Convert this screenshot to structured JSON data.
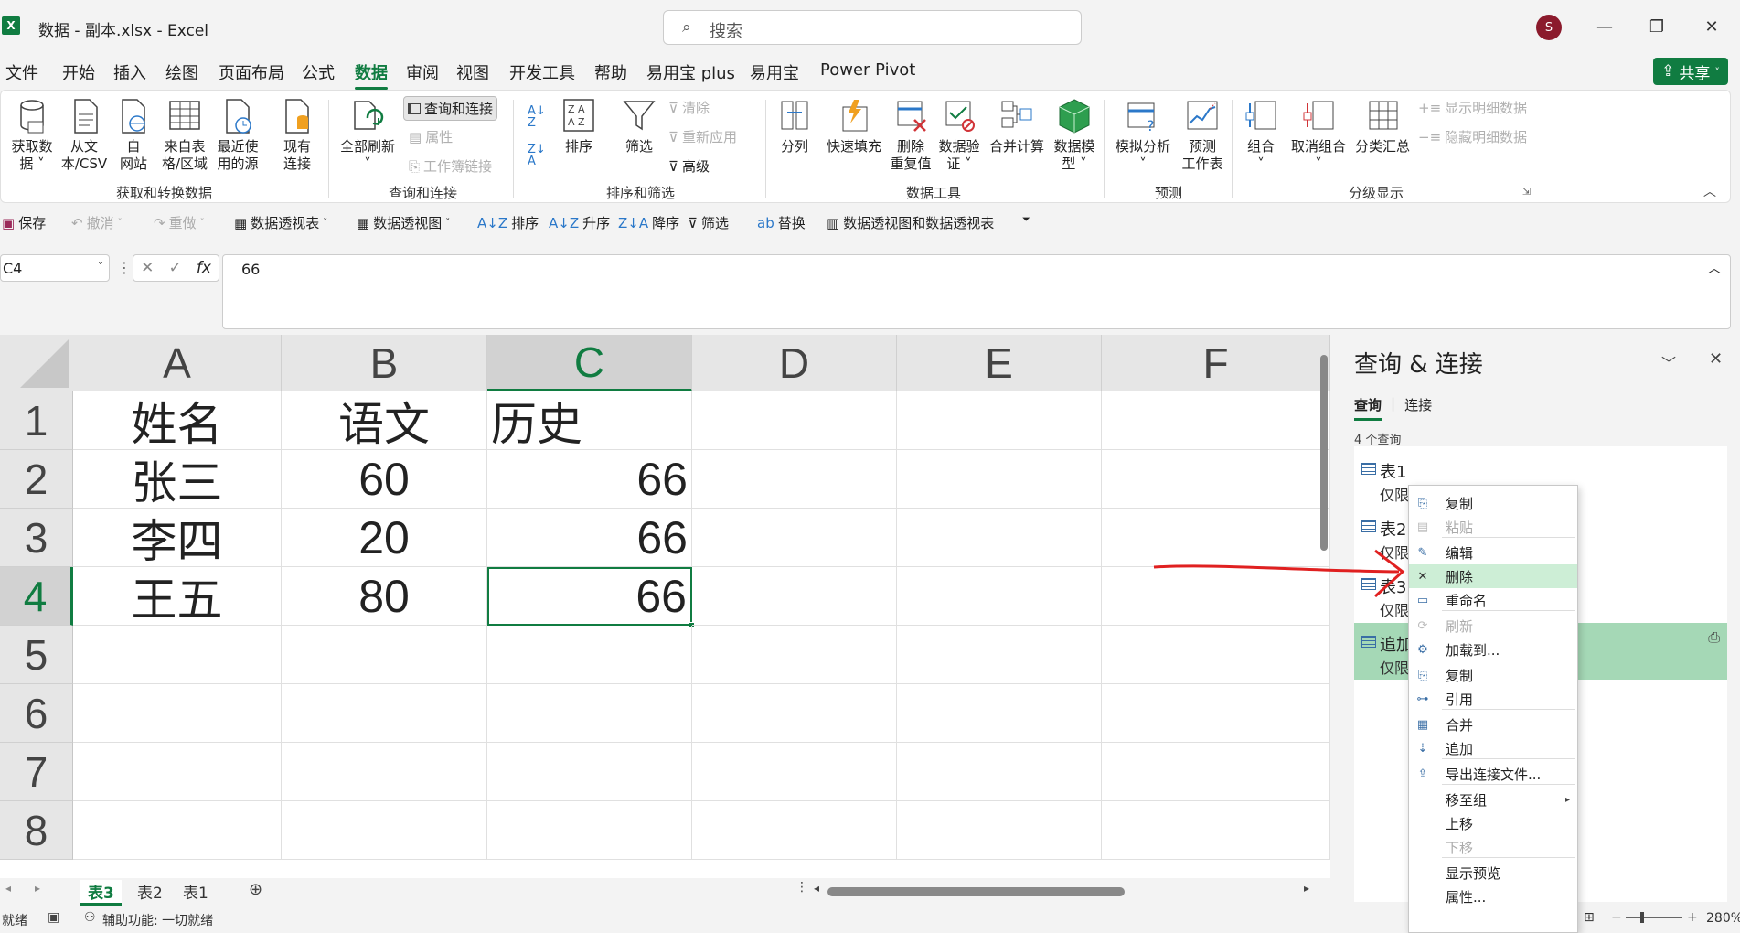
{
  "window": {
    "app_icon": "X",
    "title": "数据 - 副本.xlsx  -  Excel",
    "search_placeholder": "搜索",
    "user_initial": "S",
    "minimize": "—",
    "restore": "❐",
    "close": "✕"
  },
  "menubar": {
    "items": [
      "文件",
      "开始",
      "插入",
      "绘图",
      "页面布局",
      "公式",
      "数据",
      "审阅",
      "视图",
      "开发工具",
      "帮助",
      "易用宝 plus",
      "易用宝",
      "Power Pivot"
    ],
    "active": "数据",
    "share_label": "共享"
  },
  "ribbon": {
    "get_data": "获取数\n据 ˅",
    "from_text": "从文\n本/CSV",
    "from_web": "自\n网站",
    "from_table": "来自表\n格/区域",
    "recent_sources": "最近使\n用的源",
    "existing_conn": "现有\n连接",
    "group_get": "获取和转换数据",
    "refresh_all": "全部刷新\n˅",
    "queries_conn": "查询和连接",
    "properties": "属性",
    "workbook_links": "工作簿链接",
    "group_queries": "查询和连接",
    "sort": "排序",
    "filter": "筛选",
    "clear": "清除",
    "reapply": "重新应用",
    "advanced": "高级",
    "group_sort": "排序和筛选",
    "text_to_col": "分列",
    "flash_fill": "快速填充",
    "remove_dup": "删除\n重复值",
    "data_valid": "数据验\n证 ˅",
    "consolidate": "合并计算",
    "data_model": "数据模\n型 ˅",
    "group_tools": "数据工具",
    "what_if": "模拟分析\n˅",
    "forecast": "预测\n工作表",
    "group_forecast": "预测",
    "group_btn": "组合\n˅",
    "ungroup": "取消组合\n˅",
    "subtotal": "分类汇总",
    "show_detail": "显示明细数据",
    "hide_detail": "隐藏明细数据",
    "group_outline": "分级显示"
  },
  "qat": {
    "save": "保存",
    "undo": "撤消",
    "redo": "重做",
    "pivot_table": "数据透视表",
    "pivot_view": "数据透视图",
    "sort": "排序",
    "asc": "升序",
    "desc": "降序",
    "filter": "筛选",
    "replace": "替换",
    "pivot_both": "数据透视图和数据透视表"
  },
  "formula": {
    "name_box": "C4",
    "fx": "fx",
    "value": "66"
  },
  "sheet": {
    "columns": [
      "A",
      "B",
      "C",
      "D",
      "E",
      "F"
    ],
    "rows": [
      "1",
      "2",
      "3",
      "4",
      "5",
      "6",
      "7",
      "8"
    ],
    "cells": [
      [
        "姓名",
        "语文",
        "历史",
        "",
        "",
        ""
      ],
      [
        "张三",
        "60",
        "66",
        "",
        "",
        ""
      ],
      [
        "李四",
        "20",
        "66",
        "",
        "",
        ""
      ],
      [
        "王五",
        "80",
        "66",
        "",
        "",
        ""
      ]
    ],
    "active_cell": "C4",
    "tabs": [
      "表3",
      "表2",
      "表1"
    ],
    "active_tab": "表3"
  },
  "status": {
    "ready": "就绪",
    "accessibility": "辅助功能: 一切就绪",
    "zoom": "280%"
  },
  "query_pane": {
    "title": "查询 & 连接",
    "tab_queries": "查询",
    "tab_connections": "连接",
    "count": "4 个查询",
    "items": [
      {
        "name": "表1",
        "sub": "仅限"
      },
      {
        "name": "表2",
        "sub": "仅限"
      },
      {
        "name": "表3",
        "sub": "仅限"
      },
      {
        "name": "追加",
        "sub": "仅限"
      }
    ]
  },
  "context_menu": {
    "items": [
      {
        "label": "复制",
        "icon": "copy-icon",
        "disabled": false
      },
      {
        "label": "粘贴",
        "icon": "paste-icon",
        "disabled": true
      },
      {
        "label": "编辑",
        "icon": "edit-icon",
        "disabled": false
      },
      {
        "label": "删除",
        "icon": "delete-icon",
        "disabled": false,
        "hover": true
      },
      {
        "label": "重命名",
        "icon": "rename-icon",
        "disabled": false
      },
      {
        "label": "刷新",
        "icon": "refresh-icon",
        "disabled": true
      },
      {
        "label": "加载到...",
        "icon": "load-to-icon",
        "disabled": false
      },
      {
        "label": "复制",
        "icon": "duplicate-icon",
        "disabled": false
      },
      {
        "label": "引用",
        "icon": "reference-icon",
        "disabled": false
      },
      {
        "label": "合并",
        "icon": "merge-icon",
        "disabled": false
      },
      {
        "label": "追加",
        "icon": "append-icon",
        "disabled": false
      },
      {
        "label": "导出连接文件...",
        "icon": "export-icon",
        "disabled": false
      },
      {
        "label": "移至组",
        "icon": "",
        "disabled": false,
        "submenu": true
      },
      {
        "label": "上移",
        "icon": "",
        "disabled": false
      },
      {
        "label": "下移",
        "icon": "",
        "disabled": true
      },
      {
        "label": "显示预览",
        "icon": "",
        "disabled": false
      },
      {
        "label": "属性...",
        "icon": "",
        "disabled": false
      }
    ]
  },
  "colors": {
    "accent": "#107c41",
    "selected_query": "#a5d8b6",
    "annotation_arrow": "#e02020"
  }
}
